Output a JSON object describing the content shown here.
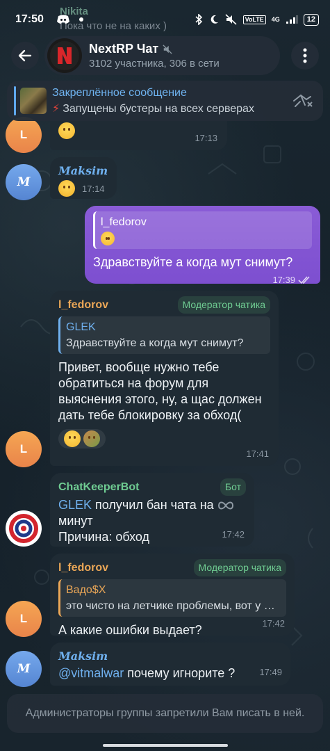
{
  "status_bar": {
    "time": "17:50",
    "network": "4G",
    "battery": "12"
  },
  "ghost_message": {
    "sender": "Nikita",
    "text": "Пока что не на каких )"
  },
  "header": {
    "title": "NextRP Чат",
    "subtitle": "3102 участника, 306 в сети"
  },
  "pinned": {
    "title": "Закреплённое сообщение",
    "text": "Запущены бустеры на всех серверах"
  },
  "messages": [
    {
      "id": "m1",
      "time": "17:13"
    },
    {
      "id": "m2",
      "sender": "Maksim",
      "time": "17:14"
    },
    {
      "id": "m3",
      "reply_name": "l_fedorov",
      "text": "Здравствуйте а когда мут снимут?",
      "time": "17:39"
    },
    {
      "id": "m4",
      "sender": "l_fedorov",
      "role": "Модератор чатика",
      "reply_name": "GLEK",
      "reply_text": "Здравствуйте а когда мут снимут?",
      "text": "Привет, вообще нужно тебе обратиться на форум для выяснения этого, ну, а щас должен дать тебе блокировку за обход(",
      "time": "17:41"
    },
    {
      "id": "m5",
      "sender": "ChatKeeperBot",
      "role": "Бот",
      "user_link": "GLEK",
      "text_1": " получил бан чата на ",
      "text_2": "минут",
      "reason": "Причина: обход",
      "time": "17:42"
    },
    {
      "id": "m6",
      "sender": "l_fedorov",
      "role": "Модератор чатика",
      "reply_name": "Вадо$X",
      "reply_text": "это чисто на летчике проблемы, вот у меня",
      "text": "А какие ошибки выдает?",
      "time": "17:42"
    },
    {
      "id": "m7",
      "sender": "Maksim",
      "mention": "@vitmalwar",
      "text": " почему игнорите ?",
      "time": "17:49"
    }
  ],
  "avatars": {
    "L": "L",
    "M": "M"
  },
  "footer": {
    "text": "Администраторы группы запретили Вам писать в ней."
  },
  "colors": {
    "accent_blue": "#6fb0ee",
    "outgoing_purple": "#7d4fd0",
    "moderator_orange": "#eba757",
    "role_green": "#6fcc92"
  }
}
